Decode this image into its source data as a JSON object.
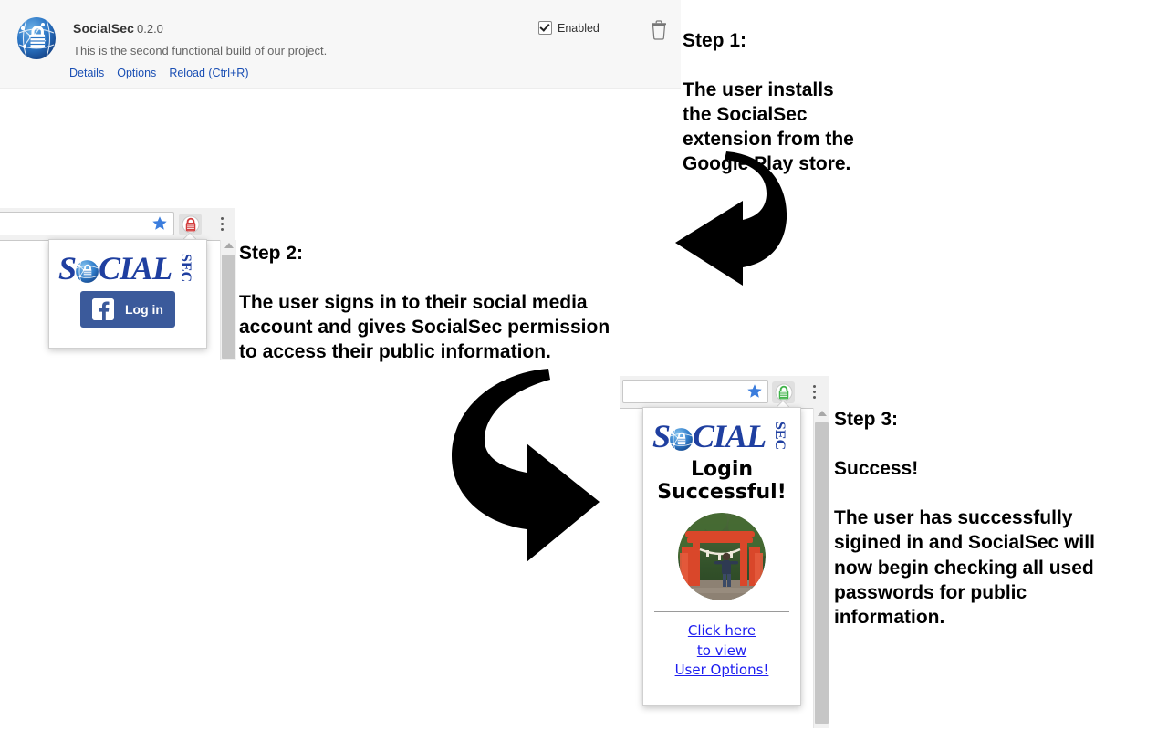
{
  "extension_row": {
    "icon": "socialsec-shield-lock-icon",
    "name": "SocialSec",
    "version": "0.2.0",
    "description": "This is the second functional build of our project.",
    "links": [
      {
        "label": "Details",
        "name": "details-link",
        "hovered": false
      },
      {
        "label": "Options",
        "name": "options-link",
        "hovered": true
      },
      {
        "label": "Reload (Ctrl+R)",
        "name": "reload-link",
        "hovered": false
      }
    ],
    "enabled_label": "Enabled",
    "enabled_checked": true,
    "remove_icon": "trash-icon",
    "link_color": "#1a4fb4",
    "background": "#f7f7f7"
  },
  "steps": [
    {
      "id": "step-1",
      "heading": "Step 1:",
      "body": "The user installs\nthe SocialSec\nextension from the\nGoogle Play store."
    },
    {
      "id": "step-2",
      "heading": "Step 2:",
      "body": "The user signs in to their social media\naccount and gives SocialSec permission\nto access their public information."
    },
    {
      "id": "step-3",
      "heading": "Step 3:",
      "body": "Success!\n\nThe user has successfully\nsigined in and SocialSec will\nnow begin checking all used\npasswords for public\ninformation."
    }
  ],
  "arrows": [
    {
      "name": "curved-arrow-down-left-icon",
      "direction": "left",
      "color": "#000000"
    },
    {
      "name": "curved-arrow-down-right-icon",
      "direction": "right",
      "color": "#000000"
    }
  ],
  "browser_step2": {
    "star_icon": "bookmark-star-icon",
    "extension_icon": "socialsec-padlock-icon-red",
    "extension_icon_color": "#d23b3b",
    "menu_icon": "kebab-menu-icon",
    "popup": {
      "logo_text": "SOCIAL",
      "logo_sub": "SEC",
      "login_button_label": "Log in",
      "login_provider_icon": "facebook-f-icon",
      "login_button_color": "#3b5a9b"
    },
    "scrollbar": "vertical-scrollbar"
  },
  "browser_step3": {
    "star_icon": "bookmark-star-icon",
    "extension_icon": "socialsec-padlock-icon-green",
    "extension_icon_color": "#41b34a",
    "menu_icon": "kebab-menu-icon",
    "popup": {
      "logo_text": "SOCIAL",
      "logo_sub": "SEC",
      "title_line1": "Login",
      "title_line2": "Successful!",
      "avatar": "user-profile-photo-torii-gate",
      "links": [
        "Click here",
        "to view",
        "User Options!"
      ],
      "link_color": "#1d1df0"
    },
    "scrollbar": "vertical-scrollbar"
  }
}
